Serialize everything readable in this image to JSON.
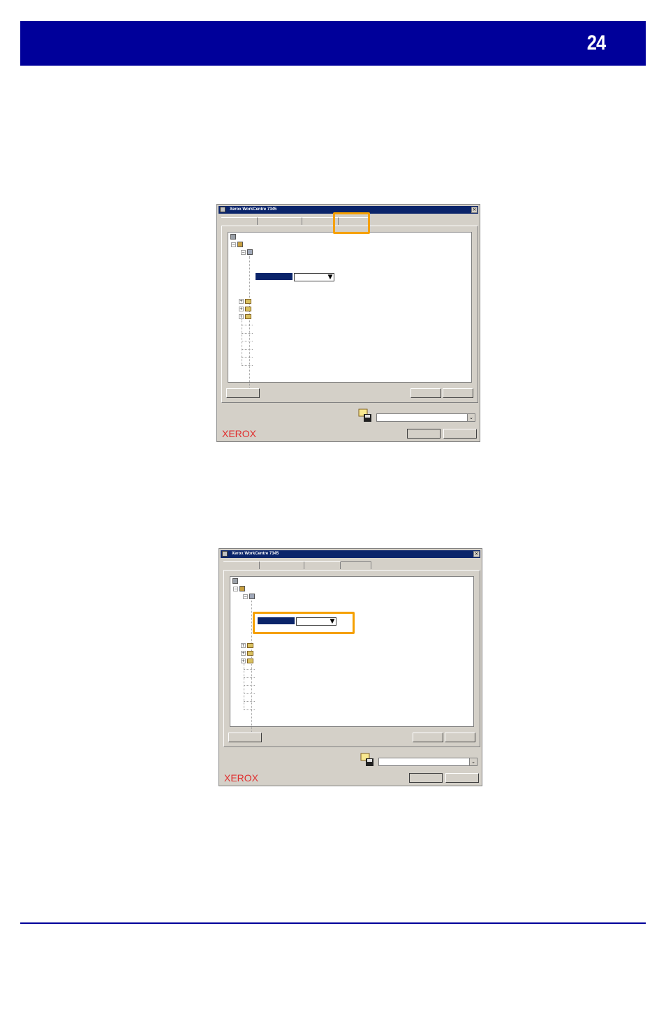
{
  "header": {
    "page_number": "24"
  },
  "screenshots": [
    {
      "window_title": "Xerox WorkCentre 7345",
      "close_glyph": "×",
      "logo": "XEROX",
      "highlight": "tab-4"
    },
    {
      "window_title": "Xerox WorkCentre 7345",
      "close_glyph": "×",
      "logo": "XEROX",
      "highlight": "dropdown"
    }
  ],
  "colors": {
    "header": "#00009a",
    "highlight": "#f5a000",
    "logo": "#e03030",
    "selection": "#0a246a"
  },
  "icons": [
    "printer-icon",
    "folder-icon",
    "save-icon",
    "close-icon",
    "dropdown-arrow-icon"
  ]
}
